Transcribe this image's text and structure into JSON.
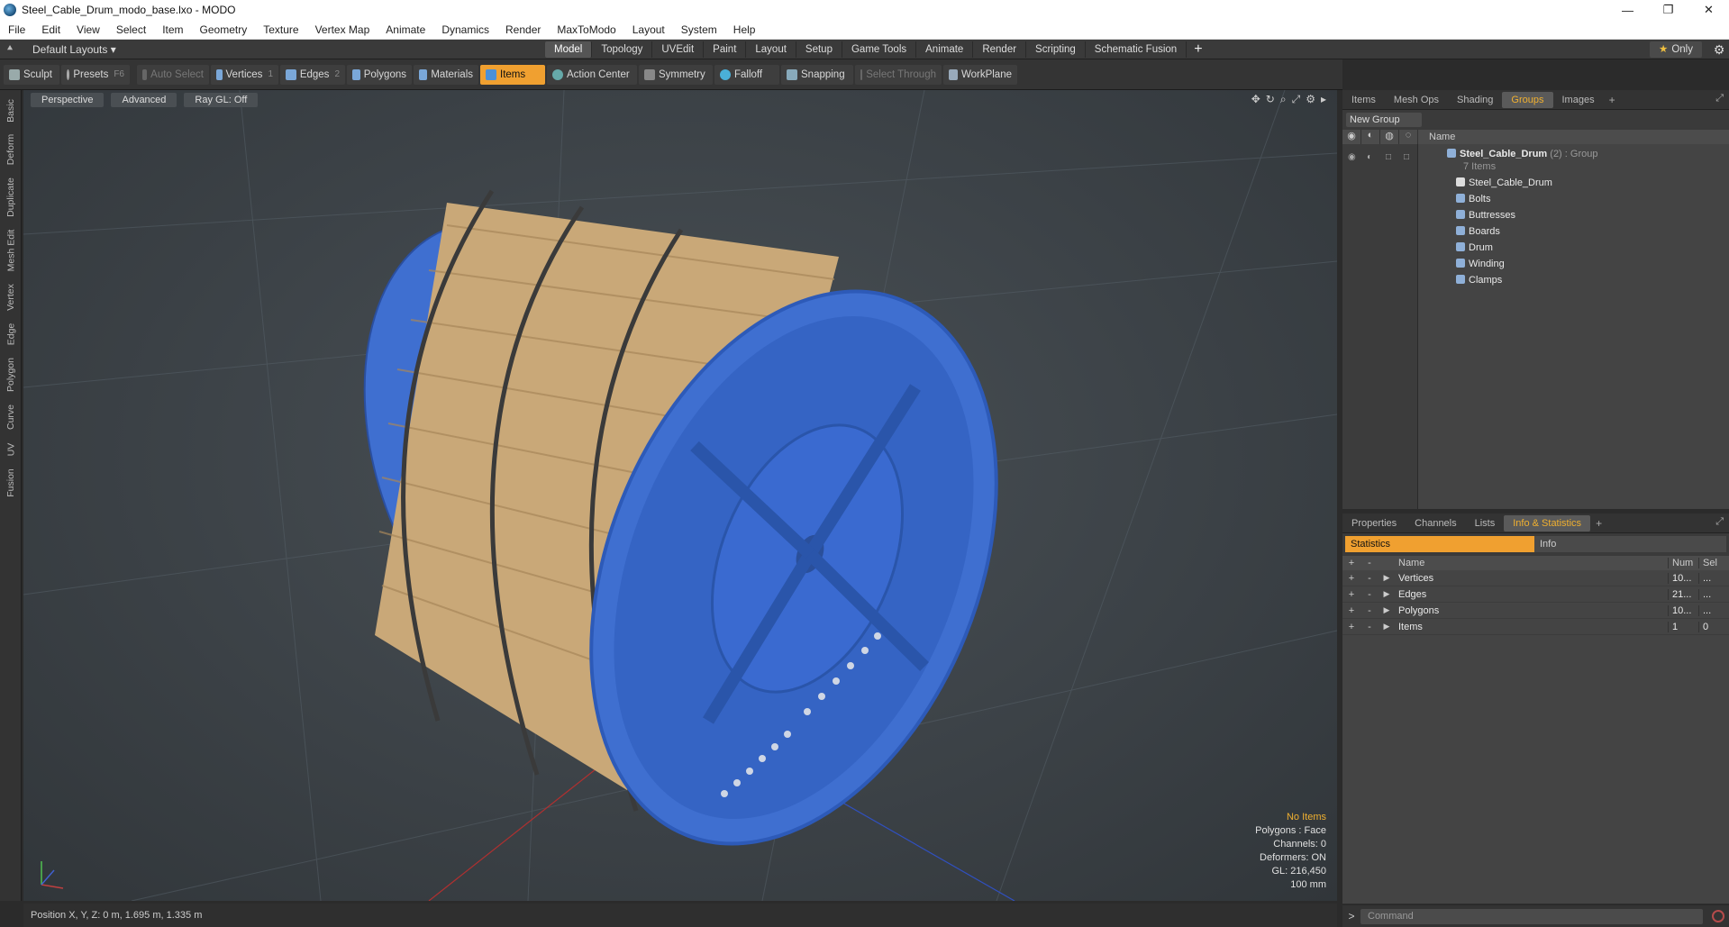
{
  "window": {
    "title": "Steel_Cable_Drum_modo_base.lxo - MODO",
    "controls": [
      "—",
      "❐",
      "✕"
    ]
  },
  "menu": [
    "File",
    "Edit",
    "View",
    "Select",
    "Item",
    "Geometry",
    "Texture",
    "Vertex Map",
    "Animate",
    "Dynamics",
    "Render",
    "MaxToModo",
    "Layout",
    "System",
    "Help"
  ],
  "layoutbar": {
    "layouts_label": "Default Layouts ▾",
    "tabs": [
      "Model",
      "Topology",
      "UVEdit",
      "Paint",
      "Layout",
      "Setup",
      "Game Tools",
      "Animate",
      "Render",
      "Scripting",
      "Schematic Fusion"
    ],
    "active_tab": "Model",
    "only_label": "Only"
  },
  "toolbar": {
    "sculpt": "Sculpt",
    "presets": "Presets",
    "presets_key": "F6",
    "auto_select": "Auto Select",
    "vertices": "Vertices",
    "vertices_key": "1",
    "edges": "Edges",
    "edges_key": "2",
    "polygons": "Polygons",
    "materials": "Materials",
    "items": "Items",
    "action_center": "Action Center",
    "symmetry": "Symmetry",
    "falloff": "Falloff",
    "snapping": "Snapping",
    "select_through": "Select Through",
    "workplane": "WorkPlane"
  },
  "left_tabs": [
    "Basic",
    "Deform",
    "Duplicate",
    "Mesh Edit",
    "Vertex",
    "Edge",
    "Polygon",
    "Curve",
    "UV",
    "Fusion"
  ],
  "viewport": {
    "view": "Perspective",
    "shading": "Advanced",
    "raygl": "Ray GL: Off",
    "stats": {
      "no_items": "No Items",
      "polygons": "Polygons : Face",
      "channels": "Channels: 0",
      "deformers": "Deformers: ON",
      "gl": "GL: 216,450",
      "scale": "100 mm"
    }
  },
  "status": "Position X, Y, Z:  0 m, 1.695 m, 1.335 m",
  "groups_panel": {
    "tabs": [
      "Items",
      "Mesh Ops",
      "Shading",
      "Groups",
      "Images"
    ],
    "active_tab": "Groups",
    "new_group": "New Group",
    "name_col": "Name",
    "root": {
      "name": "Steel_Cable_Drum",
      "count": "(2)",
      "kind": ": Group",
      "subtitle": "7 Items"
    },
    "children": [
      "Steel_Cable_Drum",
      "Bolts",
      "Buttresses",
      "Boards",
      "Drum",
      "Winding",
      "Clamps"
    ]
  },
  "stats_panel": {
    "tabs": [
      "Properties",
      "Channels",
      "Lists",
      "Info & Statistics"
    ],
    "active_tab": "Info & Statistics",
    "sub_tabs": [
      "Statistics",
      "Info"
    ],
    "headers": {
      "name": "Name",
      "num": "Num",
      "sel": "Sel"
    },
    "rows": [
      {
        "name": "Vertices",
        "num": "10...",
        "sel": "..."
      },
      {
        "name": "Edges",
        "num": "21...",
        "sel": "..."
      },
      {
        "name": "Polygons",
        "num": "10...",
        "sel": "..."
      },
      {
        "name": "Items",
        "num": "1",
        "sel": "0"
      }
    ]
  },
  "command": {
    "prompt": ">",
    "placeholder": "Command"
  },
  "colors": {
    "accent": "#f0a030",
    "drum_blue": "#3f6fd0",
    "wood": "#c9a878"
  }
}
